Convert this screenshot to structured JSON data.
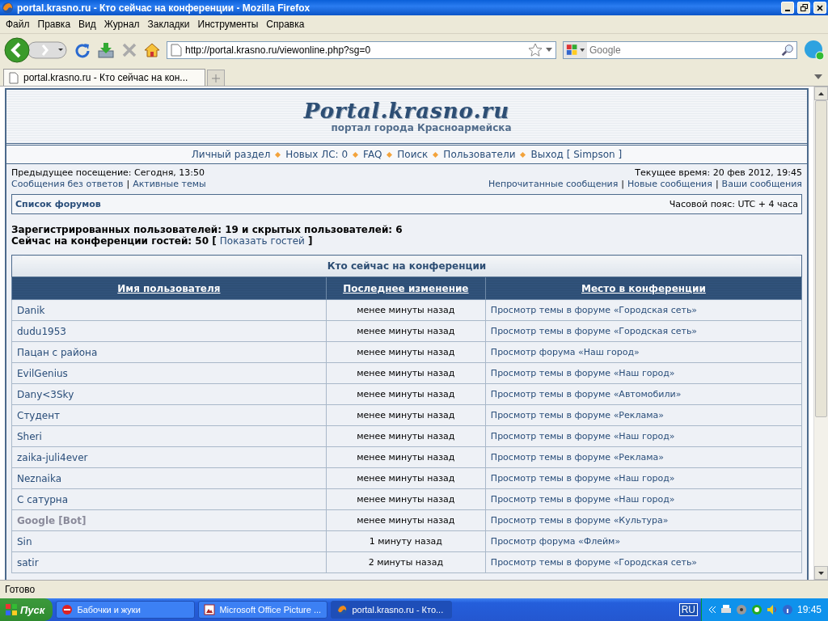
{
  "window": {
    "title": "portal.krasno.ru - Кто сейчас на конференции - Mozilla Firefox"
  },
  "menu": [
    "Файл",
    "Правка",
    "Вид",
    "Журнал",
    "Закладки",
    "Инструменты",
    "Справка"
  ],
  "address": {
    "value": "http://portal.krasno.ru/viewonline.php?sg=0"
  },
  "search": {
    "placeholder": "Google"
  },
  "tabs": [
    {
      "label": "portal.krasno.ru - Кто сейчас на кон...",
      "selected": true
    }
  ],
  "forum": {
    "logo": "Portal.krasno.ru",
    "subtitle": "портал города Красноармейска",
    "nav": [
      "Личный раздел",
      "Новых ЛС: 0",
      "FAQ",
      "Поиск",
      "Пользователи",
      "Выход [ Simpson ]"
    ],
    "last_visit": "Предыдущее посещение: Сегодня, 13:50",
    "current_time": "Текущее время: 20 фев 2012, 19:45",
    "links_left": [
      "Сообщения без ответов",
      "Активные темы"
    ],
    "link_separator": "|",
    "links_right": [
      "Непрочитанные сообщения",
      "Новые сообщения",
      "Ваши сообщения"
    ],
    "breadcrumb": "Список форумов",
    "timezone": "Часовой пояс: UTC + 4 часа",
    "stats": "Зарегистрированных пользователей: 19 и скрытых пользователей: 6",
    "guests": {
      "text": "Сейчас на конференции гостей: 50 [ ",
      "link": "Показать гостей",
      "after": " ]"
    },
    "table": {
      "title": "Кто сейчас на конференции",
      "columns": [
        "Имя пользователя",
        "Последнее изменение",
        "Место в конференции"
      ],
      "rows": [
        {
          "name": "Danik",
          "kind": "user",
          "time": "менее минуты назад",
          "place": "Просмотр темы в форуме «Городская сеть»"
        },
        {
          "name": "dudu1953",
          "kind": "user",
          "time": "менее минуты назад",
          "place": "Просмотр темы в форуме «Городская сеть»"
        },
        {
          "name": "Пацан с района",
          "kind": "user",
          "time": "менее минуты назад",
          "place": "Просмотр форума «Наш город»"
        },
        {
          "name": "EvilGenius",
          "kind": "user",
          "time": "менее минуты назад",
          "place": "Просмотр темы в форуме «Наш город»"
        },
        {
          "name": "Dany<3Sky",
          "kind": "user",
          "time": "менее минуты назад",
          "place": "Просмотр темы в форуме «Автомобили»"
        },
        {
          "name": "Студент",
          "kind": "user",
          "time": "менее минуты назад",
          "place": "Просмотр темы в форуме «Реклама»"
        },
        {
          "name": "Sheri",
          "kind": "user",
          "time": "менее минуты назад",
          "place": "Просмотр темы в форуме «Наш город»"
        },
        {
          "name": "zaika-juli4ever",
          "kind": "user",
          "time": "менее минуты назад",
          "place": "Просмотр темы в форуме «Реклама»"
        },
        {
          "name": "Neznaika",
          "kind": "user",
          "time": "менее минуты назад",
          "place": "Просмотр темы в форуме «Наш город»"
        },
        {
          "name": "С сатурна",
          "kind": "user",
          "time": "менее минуты назад",
          "place": "Просмотр темы в форуме «Наш город»"
        },
        {
          "name": "Google [Bot]",
          "kind": "bot",
          "time": "менее минуты назад",
          "place": "Просмотр темы в форуме «Культура»"
        },
        {
          "name": "Sin",
          "kind": "user",
          "time": "1 минуту назад",
          "place": "Просмотр форума «Флейм»"
        },
        {
          "name": "satir",
          "kind": "user",
          "time": "2 минуты назад",
          "place": "Просмотр темы в форуме «Городская сеть»"
        }
      ]
    }
  },
  "status_bar": "Готово",
  "taskbar": {
    "start": "Пуск",
    "tasks": [
      {
        "label": "Бабочки и жуки",
        "kind": "stop",
        "selected": false
      },
      {
        "label": "Microsoft Office Picture ...",
        "kind": "picture",
        "selected": false
      },
      {
        "label": "portal.krasno.ru - Кто...",
        "kind": "browser",
        "selected": true
      }
    ],
    "language": "RU",
    "clock": "19:45"
  }
}
